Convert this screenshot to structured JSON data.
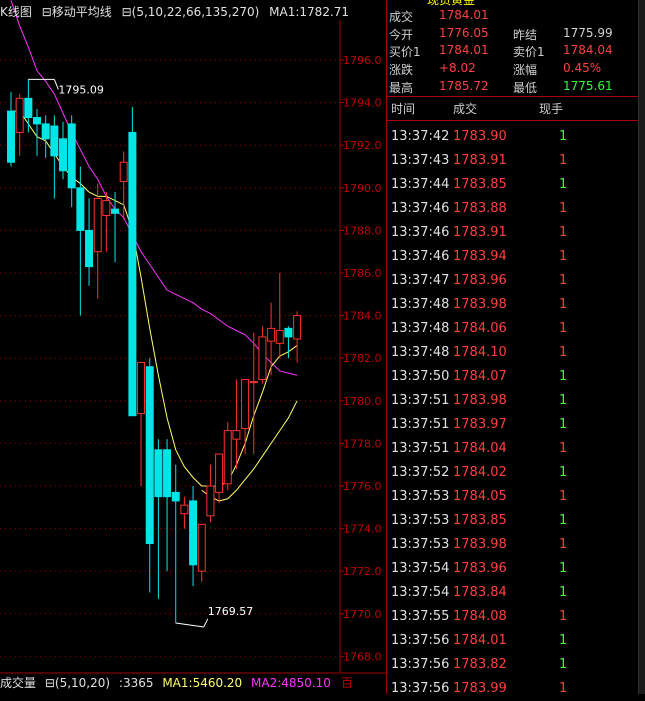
{
  "chart_header": {
    "k_label": "K线图",
    "ma_prefix": "⊟移动平均线",
    "ma_params": "⊟(5,10,22,66,135,270)",
    "ma1_label": "MA1:1782.71"
  },
  "volume_header": {
    "label": "成交量",
    "params": "⊟(5,10,20)",
    "value": ":3365",
    "ma1": "MA1:5460.20",
    "ma2": "MA2:4850.10",
    "btn": "百"
  },
  "colors": {
    "up": "#ff3030",
    "down": "#00e5e5",
    "ma1": "#ffff66",
    "ma2": "#ff33ff",
    "grid": "#a00000"
  },
  "chart_data": {
    "type": "candlestick",
    "y_ticks": [
      "1796.0",
      "1794.0",
      "1792.0",
      "1790.0",
      "1788.0",
      "1786.0",
      "1784.0",
      "1782.0",
      "1780.0",
      "1778.0",
      "1776.0",
      "1774.0",
      "1772.0",
      "1770.0",
      "1768.0"
    ],
    "ylim": [
      1767.5,
      1796.5
    ],
    "annotations": [
      {
        "text": "1795.09",
        "value": 1795.09,
        "index": 2
      },
      {
        "text": "1769.57",
        "value": 1769.57,
        "index": 19
      }
    ],
    "candles": [
      {
        "o": 1793.6,
        "h": 1794.5,
        "l": 1791.0,
        "c": 1791.2
      },
      {
        "o": 1792.6,
        "h": 1794.4,
        "l": 1791.5,
        "c": 1794.2
      },
      {
        "o": 1794.2,
        "h": 1795.09,
        "l": 1792.6,
        "c": 1793.3
      },
      {
        "o": 1793.3,
        "h": 1793.7,
        "l": 1791.5,
        "c": 1793.0
      },
      {
        "o": 1793.0,
        "h": 1793.4,
        "l": 1791.4,
        "c": 1792.3
      },
      {
        "o": 1792.9,
        "h": 1793.4,
        "l": 1789.5,
        "c": 1791.5
      },
      {
        "o": 1792.3,
        "h": 1793.1,
        "l": 1790.4,
        "c": 1790.8
      },
      {
        "o": 1793.0,
        "h": 1793.4,
        "l": 1789.1,
        "c": 1790.0
      },
      {
        "o": 1790.0,
        "h": 1791.0,
        "l": 1784.0,
        "c": 1788.0
      },
      {
        "o": 1788.0,
        "h": 1789.5,
        "l": 1785.4,
        "c": 1786.3
      },
      {
        "o": 1787.0,
        "h": 1790.2,
        "l": 1784.8,
        "c": 1789.5
      },
      {
        "o": 1788.7,
        "h": 1789.8,
        "l": 1787.0,
        "c": 1789.4
      },
      {
        "o": 1789.0,
        "h": 1789.8,
        "l": 1786.5,
        "c": 1788.8
      },
      {
        "o": 1790.3,
        "h": 1791.7,
        "l": 1788.5,
        "c": 1791.2
      },
      {
        "o": 1792.6,
        "h": 1793.8,
        "l": 1779.5,
        "c": 1779.3
      },
      {
        "o": 1779.4,
        "h": 1780.0,
        "l": 1776.0,
        "c": 1781.8
      },
      {
        "o": 1781.6,
        "h": 1782.0,
        "l": 1771.0,
        "c": 1773.3
      },
      {
        "o": 1777.7,
        "h": 1778.2,
        "l": 1770.7,
        "c": 1775.5
      },
      {
        "o": 1777.7,
        "h": 1778.2,
        "l": 1772.0,
        "c": 1775.5
      },
      {
        "o": 1775.7,
        "h": 1777.0,
        "l": 1769.57,
        "c": 1775.3
      },
      {
        "o": 1774.7,
        "h": 1775.5,
        "l": 1774.0,
        "c": 1775.1
      },
      {
        "o": 1775.3,
        "h": 1776.0,
        "l": 1771.3,
        "c": 1772.3
      },
      {
        "o": 1772.0,
        "h": 1772.5,
        "l": 1771.5,
        "c": 1774.2
      },
      {
        "o": 1774.6,
        "h": 1777.0,
        "l": 1774.3,
        "c": 1776.0
      },
      {
        "o": 1775.7,
        "h": 1777.5,
        "l": 1775.2,
        "c": 1777.5
      },
      {
        "o": 1776.1,
        "h": 1779.0,
        "l": 1775.8,
        "c": 1778.6
      },
      {
        "o": 1778.2,
        "h": 1781.0,
        "l": 1776.8,
        "c": 1778.6
      },
      {
        "o": 1778.7,
        "h": 1781.0,
        "l": 1777.5,
        "c": 1781.0
      },
      {
        "o": 1780.9,
        "h": 1783.2,
        "l": 1777.5,
        "c": 1780.9
      },
      {
        "o": 1781.0,
        "h": 1783.5,
        "l": 1780.8,
        "c": 1783.0
      },
      {
        "o": 1782.8,
        "h": 1784.6,
        "l": 1781.2,
        "c": 1783.4
      },
      {
        "o": 1782.7,
        "h": 1786.0,
        "l": 1782.0,
        "c": 1783.3
      },
      {
        "o": 1783.4,
        "h": 1783.5,
        "l": 1782.0,
        "c": 1783.0
      },
      {
        "o": 1782.9,
        "h": 1784.2,
        "l": 1781.8,
        "c": 1784.0
      }
    ],
    "ma1": [
      1793.6,
      1793.6,
      1793.0,
      1792.4,
      1792.2,
      1791.6,
      1791.0,
      1790.5,
      1790.2,
      1789.8,
      1789.6,
      1789.6,
      1789.4,
      1789.2,
      1788.0,
      1785.8,
      1783.4,
      1781.2,
      1779.2,
      1777.7,
      1776.9,
      1776.4,
      1776.0,
      1776.0,
      1776.0,
      1776.2,
      1777.0,
      1778.0,
      1779.3,
      1780.4,
      1781.6,
      1782.1,
      1782.3,
      1782.6
    ],
    "ma2": [
      1798.8,
      1797.6,
      1796.6,
      1795.5,
      1795.0,
      1794.4,
      1793.5,
      1792.6,
      1791.8,
      1791.0,
      1790.4,
      1789.6,
      1789.0,
      1788.6,
      1787.8,
      1787.0,
      1786.4,
      1785.8,
      1785.2,
      1785.0,
      1784.8,
      1784.6,
      1784.3,
      1784.1,
      1783.8,
      1783.5,
      1783.3,
      1783.1,
      1782.7,
      1782.2,
      1781.8,
      1781.4,
      1781.3,
      1781.2
    ],
    "ma3": [
      null,
      null,
      null,
      null,
      null,
      null,
      null,
      null,
      null,
      null,
      null,
      null,
      null,
      null,
      null,
      null,
      null,
      null,
      null,
      null,
      null,
      null,
      1775.8,
      1775.5,
      1775.3,
      1775.4,
      1775.8,
      1776.3,
      1776.8,
      1777.4,
      1778.0,
      1778.6,
      1779.2,
      1780.0
    ]
  },
  "quote": {
    "title_partial": "现货黄金",
    "rows": [
      {
        "l1": "成交",
        "v1": "1784.01",
        "c1": "red",
        "l2": "",
        "v2": "",
        "c2": ""
      },
      {
        "l1": "今开",
        "v1": "1776.05",
        "c1": "red",
        "l2": "昨结",
        "v2": "1775.99",
        "c2": "white"
      },
      {
        "l1": "买价1",
        "v1": "1784.01",
        "c1": "red",
        "l2": "卖价1",
        "v2": "1784.04",
        "c2": "red"
      },
      {
        "l1": "涨跌",
        "v1": "+8.02",
        "c1": "red",
        "l2": "涨幅",
        "v2": "0.45%",
        "c2": "red"
      },
      {
        "l1": "最高",
        "v1": "1785.72",
        "c1": "red",
        "l2": "最低",
        "v2": "1775.61",
        "c2": "green"
      }
    ]
  },
  "ticks_header": {
    "time": "时间",
    "price": "成交",
    "vol": "现手"
  },
  "ticks": [
    {
      "t": "13:37:42",
      "p": "1783.90",
      "v": "1",
      "vc": "green"
    },
    {
      "t": "13:37:43",
      "p": "1783.91",
      "v": "1",
      "vc": "red"
    },
    {
      "t": "13:37:44",
      "p": "1783.85",
      "v": "1",
      "vc": "green"
    },
    {
      "t": "13:37:46",
      "p": "1783.88",
      "v": "1",
      "vc": "red"
    },
    {
      "t": "13:37:46",
      "p": "1783.91",
      "v": "1",
      "vc": "red"
    },
    {
      "t": "13:37:46",
      "p": "1783.94",
      "v": "1",
      "vc": "red"
    },
    {
      "t": "13:37:47",
      "p": "1783.96",
      "v": "1",
      "vc": "red"
    },
    {
      "t": "13:37:48",
      "p": "1783.98",
      "v": "1",
      "vc": "red"
    },
    {
      "t": "13:37:48",
      "p": "1784.06",
      "v": "1",
      "vc": "red"
    },
    {
      "t": "13:37:48",
      "p": "1784.10",
      "v": "1",
      "vc": "red"
    },
    {
      "t": "13:37:50",
      "p": "1784.07",
      "v": "1",
      "vc": "green"
    },
    {
      "t": "13:37:51",
      "p": "1783.98",
      "v": "1",
      "vc": "green"
    },
    {
      "t": "13:37:51",
      "p": "1783.97",
      "v": "1",
      "vc": "green"
    },
    {
      "t": "13:37:51",
      "p": "1784.04",
      "v": "1",
      "vc": "red"
    },
    {
      "t": "13:37:52",
      "p": "1784.02",
      "v": "1",
      "vc": "green"
    },
    {
      "t": "13:37:53",
      "p": "1784.05",
      "v": "1",
      "vc": "red"
    },
    {
      "t": "13:37:53",
      "p": "1783.85",
      "v": "1",
      "vc": "green"
    },
    {
      "t": "13:37:53",
      "p": "1783.98",
      "v": "1",
      "vc": "red"
    },
    {
      "t": "13:37:54",
      "p": "1783.96",
      "v": "1",
      "vc": "green"
    },
    {
      "t": "13:37:54",
      "p": "1783.84",
      "v": "1",
      "vc": "green"
    },
    {
      "t": "13:37:55",
      "p": "1784.08",
      "v": "1",
      "vc": "red"
    },
    {
      "t": "13:37:56",
      "p": "1784.01",
      "v": "1",
      "vc": "green"
    },
    {
      "t": "13:37:56",
      "p": "1783.82",
      "v": "1",
      "vc": "green"
    },
    {
      "t": "13:37:56",
      "p": "1783.99",
      "v": "1",
      "vc": "red"
    }
  ]
}
